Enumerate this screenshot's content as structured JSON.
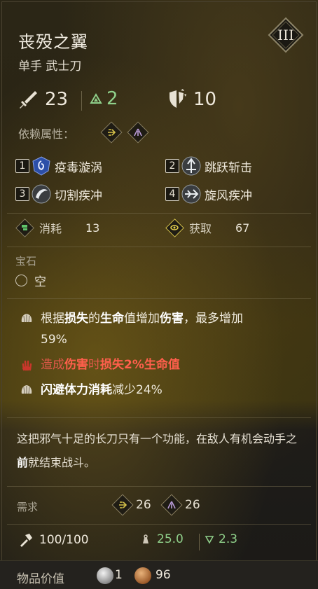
{
  "item": {
    "name": "丧殁之翼",
    "type": "单手 武士刀",
    "tier": "III"
  },
  "stats": {
    "damage": "23",
    "stagger": "2",
    "guard": "10"
  },
  "dependency": {
    "label": "依赖属性："
  },
  "skills": [
    {
      "key": "1",
      "name": "疫毒漩涡",
      "icon": "poison-vortex-icon"
    },
    {
      "key": "2",
      "name": "跳跃斩击",
      "icon": "leap-slash-icon"
    },
    {
      "key": "3",
      "name": "切割疾冲",
      "icon": "cutting-dash-icon"
    },
    {
      "key": "4",
      "name": "旋风疾冲",
      "icon": "whirlwind-dash-icon"
    }
  ],
  "costs": {
    "consume_label": "消耗",
    "consume_value": "13",
    "gain_label": "获取",
    "gain_value": "67"
  },
  "gem": {
    "title": "宝石",
    "slot": "空"
  },
  "traits": [
    {
      "pre": "根据",
      "b1": "损失",
      "mid1": "的",
      "b2": "生命",
      "mid2": "值增加",
      "b3": "伤害",
      "post": "，最多增加",
      "line2": "59%"
    },
    {
      "pre": "造成",
      "b1": "伤害",
      "mid1": "时",
      "b2": "损失2%生命值"
    },
    {
      "b1": "闪避体力消耗",
      "post": "减少24%"
    }
  ],
  "description": {
    "pre": "这把邪气十足的长刀只有一个功能，在敌人有机会动手之",
    "bold": "前",
    "post": "就结束战斗。"
  },
  "requirements": {
    "label": "需求",
    "dex": "26",
    "arcane": "26"
  },
  "footer": {
    "durability": "100/100",
    "weight": "25.0",
    "load": "2.3"
  },
  "value": {
    "label": "物品价值",
    "silver": "1",
    "copper": "96"
  },
  "colors": {
    "dex": "#d6c24a",
    "arcane": "#b99bd8",
    "green": "#8fcf8a",
    "red": "#ff5f4c"
  }
}
